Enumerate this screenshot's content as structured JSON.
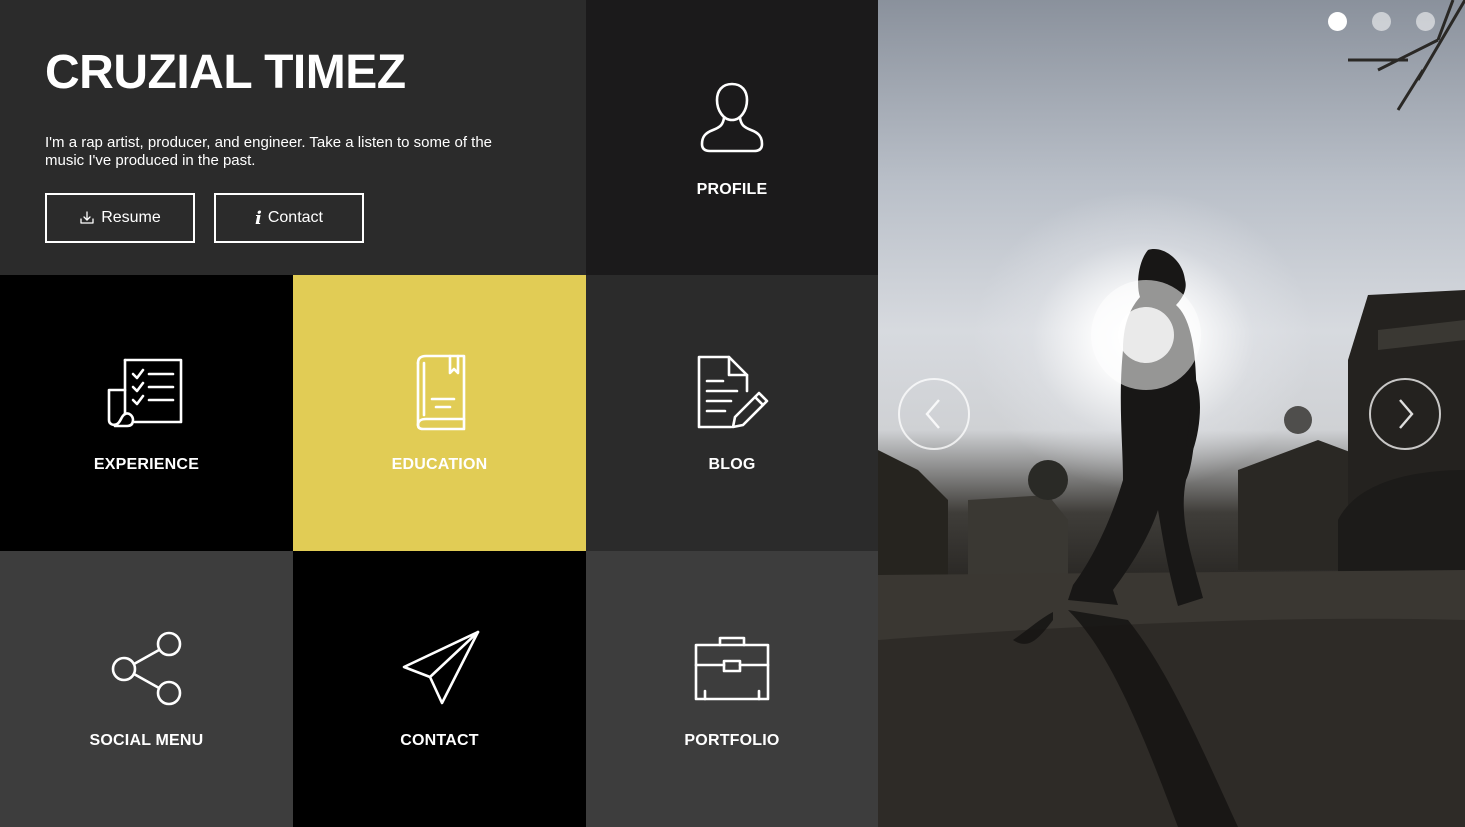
{
  "intro": {
    "title": "CRUZIAL TIMEZ",
    "bio": "I'm a rap artist, producer, and engineer. Take a listen to some of the music I've produced in the past.",
    "buttons": {
      "resume": "Resume",
      "contact": "Contact"
    }
  },
  "tiles": [
    {
      "label": "PROFILE",
      "icon": "user-icon",
      "color": "#1b1a1b"
    },
    {
      "label": "EXPERIENCE",
      "icon": "checklist-icon",
      "color": "#000000"
    },
    {
      "label": "EDUCATION",
      "icon": "book-icon",
      "color": "#e1cc55"
    },
    {
      "label": "BLOG",
      "icon": "document-edit-icon",
      "color": "#2b2b2b"
    },
    {
      "label": "SOCIAL MENU",
      "icon": "share-icon",
      "color": "#3d3d3d"
    },
    {
      "label": "CONTACT",
      "icon": "paper-plane-icon",
      "color": "#000000"
    },
    {
      "label": "PORTFOLIO",
      "icon": "briefcase-icon",
      "color": "#3d3d3d"
    }
  ],
  "slider": {
    "total_slides": 3,
    "active_slide": 1
  }
}
